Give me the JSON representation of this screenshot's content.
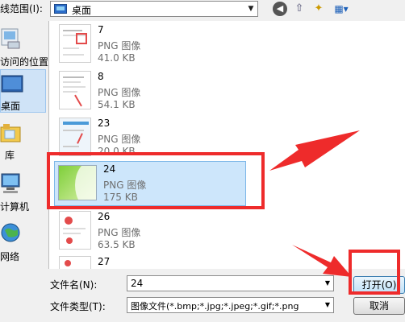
{
  "toolbar": {
    "lookin_label": "线范围(I):",
    "location": "桌面",
    "dropdown_glyph": "▼",
    "back_glyph": "◀",
    "up_glyph": "⇧",
    "newfolder_glyph": "✦",
    "view_glyph": "▦▾"
  },
  "places": [
    {
      "label": "访问的位置"
    },
    {
      "label": "桌面"
    },
    {
      "label": "库"
    },
    {
      "label": "计算机"
    },
    {
      "label": "网络"
    }
  ],
  "files": [
    {
      "name": "7",
      "type": "PNG 图像",
      "size": "41.0 KB"
    },
    {
      "name": "8",
      "type": "PNG 图像",
      "size": "54.1 KB"
    },
    {
      "name": "23",
      "type": "PNG 图像",
      "size": "20.0 KB"
    },
    {
      "name": "24",
      "type": "PNG 图像",
      "size": "175 KB"
    },
    {
      "name": "26",
      "type": "PNG 图像",
      "size": "63.5 KB"
    },
    {
      "name": "27",
      "type": "",
      "size": ""
    }
  ],
  "footer": {
    "filename_label": "文件名(N):",
    "filename_value": "24",
    "filetype_label": "文件类型(T):",
    "filetype_value": "图像文件(*.bmp;*.jpg;*.jpeg;*.gif;*.png",
    "open_label": "打开(O)",
    "cancel_label": "取消"
  },
  "colors": {
    "selection": "#cde6fb",
    "annotation_red": "#ee2b2b"
  }
}
